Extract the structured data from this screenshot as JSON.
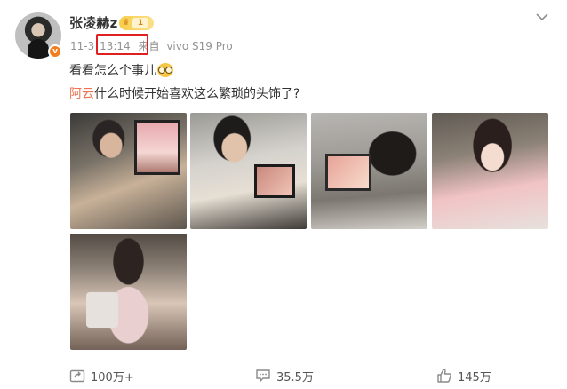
{
  "post": {
    "author": "张凌赫z",
    "vip_level": "1",
    "verified_mark": "v",
    "date": "11-3",
    "time": "13:14",
    "source_prefix": "来自",
    "device": "vivo S19 Pro",
    "text_line1": "看看怎么个事儿",
    "mention": "阿云",
    "text_line2_rest": "什么时候开始喜欢这么繁琐的头饰了?"
  },
  "actions": {
    "repost": "100万+",
    "comment": "35.5万",
    "like": "145万"
  },
  "icons": {
    "menu": "chevron-down-icon",
    "repost": "share-icon",
    "comment": "comment-icon",
    "like": "thumbs-up-icon",
    "vip": "crown-icon",
    "emoji": "glasses-emoji-icon"
  },
  "colors": {
    "mention": "#eb7350",
    "highlight_box": "#e02020",
    "meta_gray": "#939393",
    "verified_orange": "#f27d1d"
  },
  "images": [
    {
      "id": "photo-1"
    },
    {
      "id": "photo-2"
    },
    {
      "id": "photo-3"
    },
    {
      "id": "photo-4"
    },
    {
      "id": "photo-5"
    }
  ]
}
